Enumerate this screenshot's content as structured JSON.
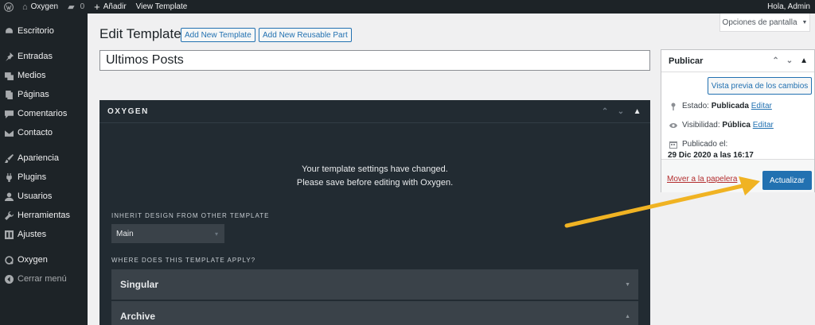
{
  "admin_bar": {
    "site_name": "Oxygen",
    "comments_count": "0",
    "new_label": "Añadir",
    "view_label": "View Template",
    "greeting": "Hola, Admin"
  },
  "sidebar": {
    "items": [
      {
        "label": "Escritorio",
        "icon": "dashboard-icon"
      },
      {
        "label": "Entradas",
        "icon": "pin-icon"
      },
      {
        "label": "Medios",
        "icon": "media-icon"
      },
      {
        "label": "Páginas",
        "icon": "pages-icon"
      },
      {
        "label": "Comentarios",
        "icon": "comment-icon"
      },
      {
        "label": "Contacto",
        "icon": "mail-icon"
      },
      {
        "label": "Apariencia",
        "icon": "brush-icon"
      },
      {
        "label": "Plugins",
        "icon": "plug-icon"
      },
      {
        "label": "Usuarios",
        "icon": "user-icon"
      },
      {
        "label": "Herramientas",
        "icon": "wrench-icon"
      },
      {
        "label": "Ajustes",
        "icon": "settings-icon"
      },
      {
        "label": "Oxygen",
        "icon": "oxygen-icon"
      },
      {
        "label": "Cerrar menú",
        "icon": "collapse-icon"
      }
    ]
  },
  "screen_options": {
    "label": "Opciones de pantalla",
    "caret": "▼"
  },
  "header": {
    "title": "Edit Template",
    "add_template": "Add New Template",
    "add_part": "Add New Reusable Part"
  },
  "title_field": {
    "value": "Ultimos Posts"
  },
  "oxygen": {
    "heading": "OXYGEN",
    "message_line1": "Your template settings have changed.",
    "message_line2": "Please save before editing with Oxygen.",
    "inherit_label": "INHERIT DESIGN FROM OTHER TEMPLATE",
    "inherit_value": "Main",
    "apply_label": "WHERE DOES THIS TEMPLATE APPLY?",
    "sections": [
      {
        "label": "Singular"
      },
      {
        "label": "Archive"
      }
    ]
  },
  "publish": {
    "title": "Publicar",
    "preview_button": "Vista previa de los cambios",
    "status_label": "Estado:",
    "status_value": "Publicada",
    "visibility_label": "Visibilidad:",
    "visibility_value": "Pública",
    "published_label": "Publicado el:",
    "published_value": "29 Dic 2020 a las 16:17",
    "edit_link": "Editar",
    "trash_link": "Mover a la papelera",
    "update_button": "Actualizar"
  },
  "colors": {
    "admin_dark": "#1d2327",
    "link_blue": "#2271b1",
    "oxygen_bg": "#222b32",
    "arrow_yellow": "#f0b323",
    "trash_red": "#b32d2e"
  }
}
